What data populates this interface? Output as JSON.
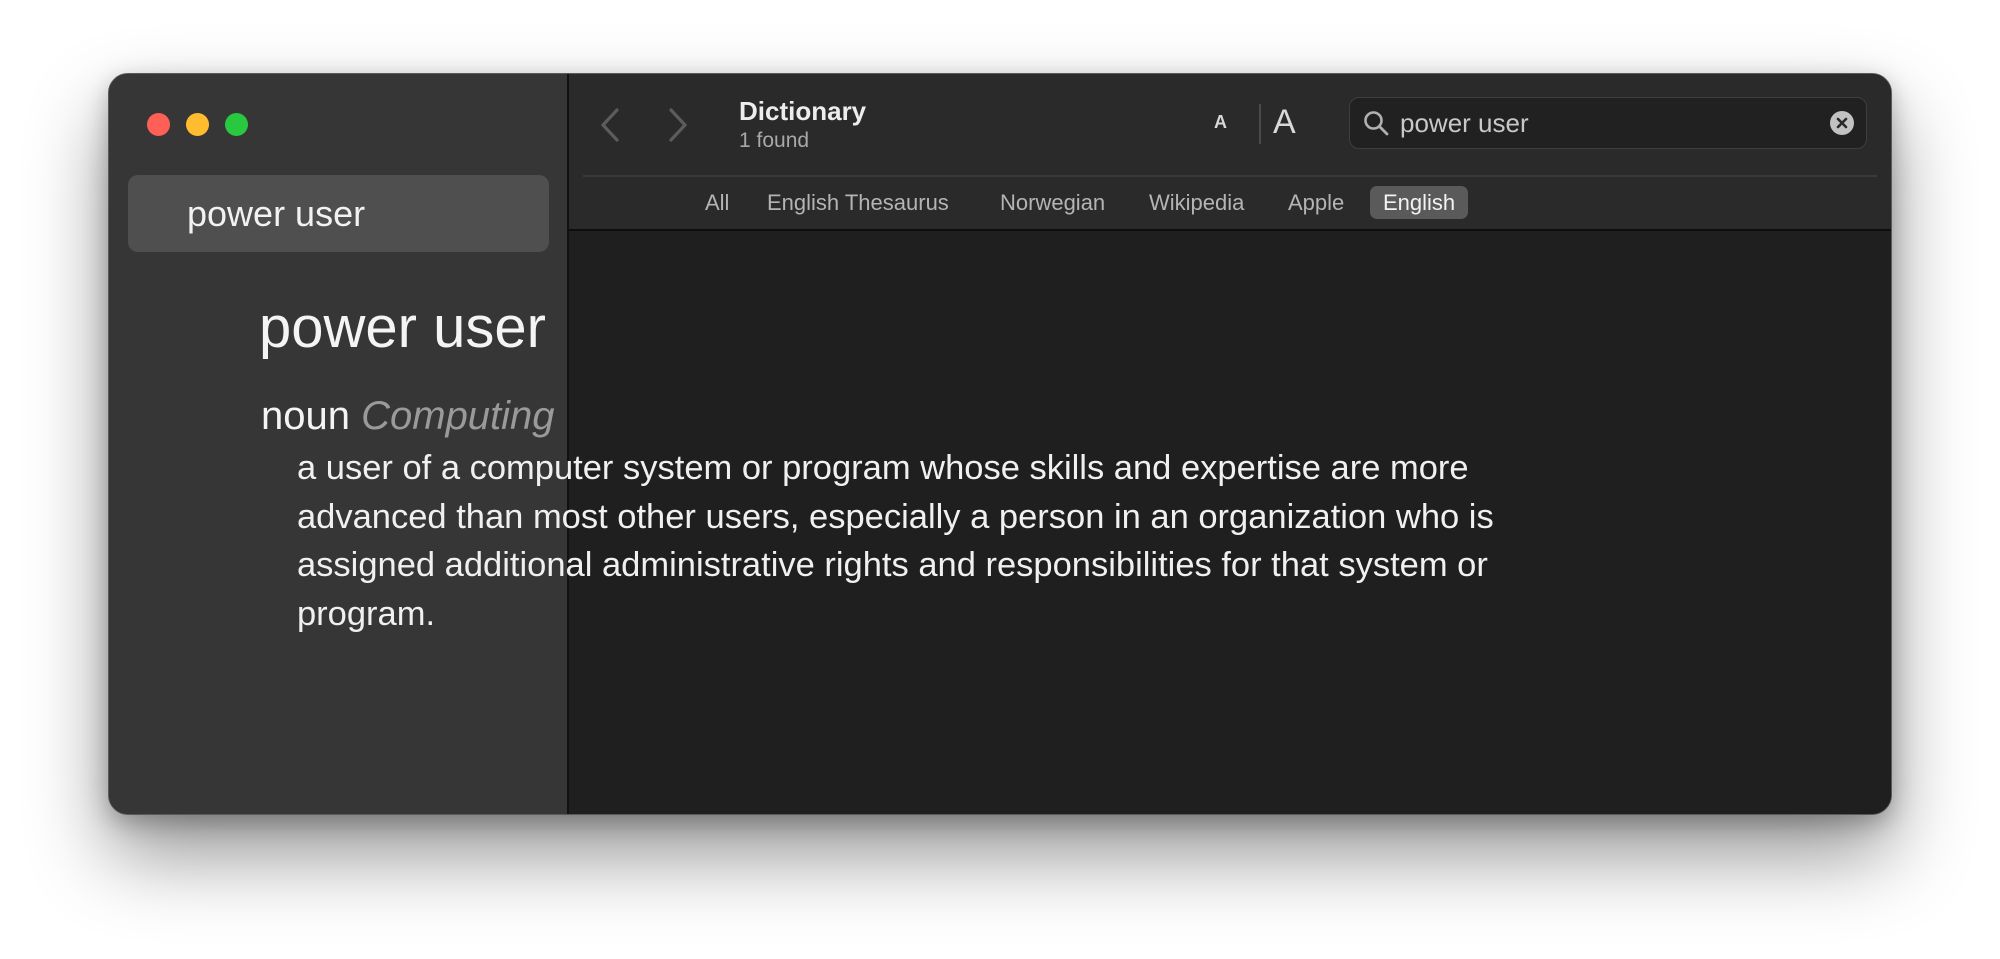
{
  "sidebar": {
    "items": [
      {
        "label": "power user"
      }
    ]
  },
  "toolbar": {
    "title": "Dictionary",
    "subtitle": "1 found",
    "font_smaller_label": "A",
    "font_larger_label": "A"
  },
  "search": {
    "value": "power user"
  },
  "tabs": [
    {
      "label": "All"
    },
    {
      "label": "English Thesaurus"
    },
    {
      "label": "Norwegian"
    },
    {
      "label": "Wikipedia"
    },
    {
      "label": "Apple"
    },
    {
      "label": "English",
      "selected": true
    }
  ],
  "entry": {
    "headword": "power user",
    "part_of_speech": "noun",
    "domain": "Computing",
    "definition": "a user of a computer system or program whose skills and expertise are more advanced than most other users, especially a person in an organization who is assigned additional administrative rights and responsibilities for that system or program."
  },
  "colors": {
    "close": "#fe5f57",
    "minimize": "#febc2e",
    "zoom": "#28c840",
    "sidebar_bg": "#363636",
    "content_bg": "#1f1f1f"
  }
}
